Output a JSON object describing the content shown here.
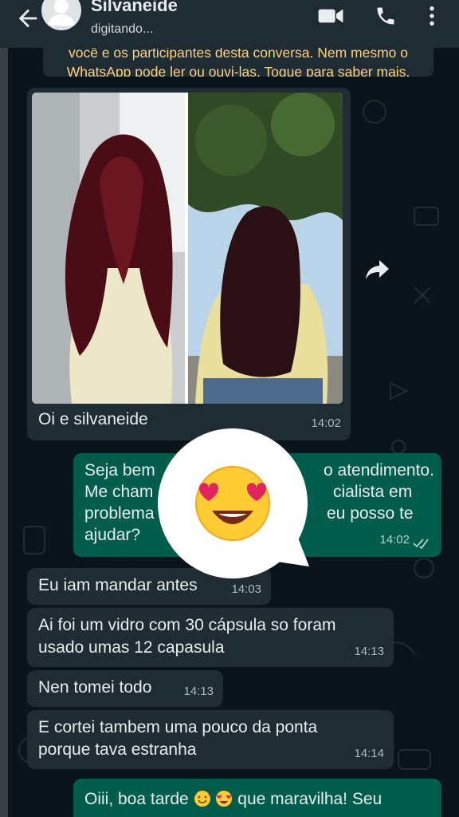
{
  "header": {
    "contact_name": "Silvaneide",
    "status": "digitando..."
  },
  "notice": {
    "line1": "você e os participantes desta conversa. Nem mesmo o",
    "line2": "WhatsApp pode ler ou ouvi-las. Toque para saber mais."
  },
  "messages": {
    "m1": {
      "text": "Oi e silvaneide",
      "time": "14:02"
    },
    "m2": {
      "line1": "Seja bem",
      "line1b": "o atendimento.",
      "line2": "Me cham",
      "line2b": "cialista em",
      "line3": "problema",
      "line3b": "eu posso te",
      "line4": "ajudar?",
      "time": "14:02"
    },
    "m3": {
      "text": "Eu iam mandar antes",
      "time": "14:03"
    },
    "m4": {
      "line1": "Ai foi um vidro com 30 cápsula  so foram",
      "line2": "usado umas 12 capasula",
      "time": "14:13"
    },
    "m5": {
      "text": "Nen tomei todo",
      "time": "14:13"
    },
    "m6": {
      "line1": "E cortei tambem uma pouco da ponta",
      "line2": "porque tava estranha",
      "time": "14:14"
    },
    "m7": {
      "text_a": "Oiii, boa tarde ",
      "text_b": " que maravilha!  Seu"
    }
  },
  "icons": {
    "back": "arrow-left-icon",
    "video": "video-call-icon",
    "call": "phone-icon",
    "menu": "more-vert-icon",
    "forward": "forward-icon",
    "emoji": "heart-eyes-emoji"
  },
  "colors": {
    "header_bg": "#1f2c34",
    "chat_bg": "#0b141a",
    "incoming": "#1f2c34",
    "outgoing": "#005c4b",
    "notice_text": "#ffd279"
  }
}
